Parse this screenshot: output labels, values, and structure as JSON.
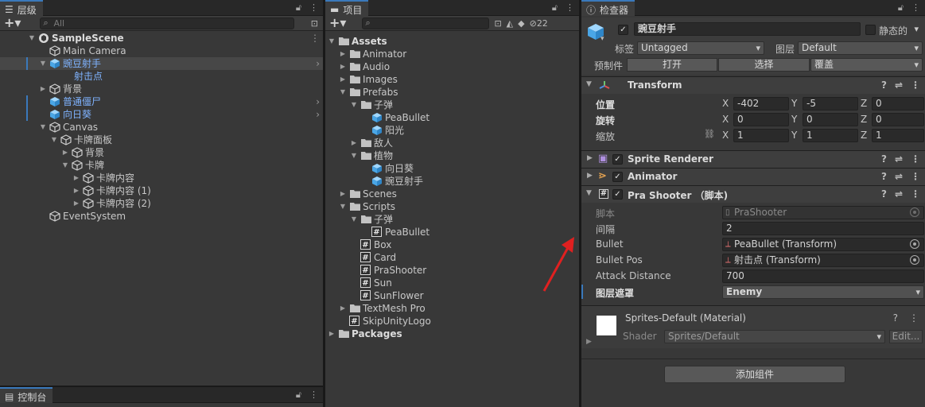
{
  "hierarchy": {
    "tab": "层级",
    "search_placeholder": "All",
    "items": [
      {
        "label": "SampleScene",
        "depth": 0,
        "arrow": "down",
        "icon": "unity-scene-icon",
        "bold": true,
        "selected": false,
        "blue": false,
        "chevron": false
      },
      {
        "label": "Main Camera",
        "depth": 1,
        "arrow": "none",
        "icon": "gameobject-icon",
        "selected": false,
        "blue": false,
        "chevron": false
      },
      {
        "label": "豌豆射手",
        "depth": 1,
        "arrow": "down",
        "icon": "prefab-icon",
        "selected": true,
        "blue": true,
        "chevron": true
      },
      {
        "label": "射击点",
        "depth": 2,
        "arrow": "none",
        "icon": "none",
        "selected": false,
        "blue": true,
        "chevron": false
      },
      {
        "label": "背景",
        "depth": 1,
        "arrow": "right",
        "icon": "gameobject-icon",
        "selected": false,
        "blue": false,
        "chevron": false
      },
      {
        "label": "普通僵尸",
        "depth": 1,
        "arrow": "none",
        "icon": "prefab-icon",
        "selected": false,
        "blue": true,
        "chevron": true
      },
      {
        "label": "向日葵",
        "depth": 1,
        "arrow": "none",
        "icon": "prefab-icon",
        "selected": false,
        "blue": true,
        "chevron": true
      },
      {
        "label": "Canvas",
        "depth": 1,
        "arrow": "down",
        "icon": "gameobject-icon",
        "selected": false,
        "blue": false,
        "chevron": false
      },
      {
        "label": "卡牌面板",
        "depth": 2,
        "arrow": "down",
        "icon": "gameobject-icon",
        "selected": false,
        "blue": false,
        "chevron": false
      },
      {
        "label": "背景",
        "depth": 3,
        "arrow": "right",
        "icon": "gameobject-icon",
        "selected": false,
        "blue": false,
        "chevron": false
      },
      {
        "label": "卡牌",
        "depth": 3,
        "arrow": "down",
        "icon": "gameobject-icon",
        "selected": false,
        "blue": false,
        "chevron": false
      },
      {
        "label": "卡牌内容",
        "depth": 4,
        "arrow": "right",
        "icon": "gameobject-icon",
        "selected": false,
        "blue": false,
        "chevron": false
      },
      {
        "label": "卡牌内容 (1)",
        "depth": 4,
        "arrow": "right",
        "icon": "gameobject-icon",
        "selected": false,
        "blue": false,
        "chevron": false
      },
      {
        "label": "卡牌内容 (2)",
        "depth": 4,
        "arrow": "right",
        "icon": "gameobject-icon",
        "selected": false,
        "blue": false,
        "chevron": false
      },
      {
        "label": "EventSystem",
        "depth": 1,
        "arrow": "none",
        "icon": "gameobject-icon",
        "selected": false,
        "blue": false,
        "chevron": false
      }
    ]
  },
  "console": {
    "tab": "控制台"
  },
  "project": {
    "tab": "项目",
    "hidden_count": "22",
    "items": [
      {
        "label": "Assets",
        "depth": 0,
        "arrow": "down",
        "icon": "folder-icon",
        "bold": true
      },
      {
        "label": "Animator",
        "depth": 1,
        "arrow": "right",
        "icon": "folder-icon"
      },
      {
        "label": "Audio",
        "depth": 1,
        "arrow": "right",
        "icon": "folder-icon"
      },
      {
        "label": "Images",
        "depth": 1,
        "arrow": "right",
        "icon": "folder-icon"
      },
      {
        "label": "Prefabs",
        "depth": 1,
        "arrow": "down",
        "icon": "folder-icon"
      },
      {
        "label": "子弹",
        "depth": 2,
        "arrow": "down",
        "icon": "folder-icon"
      },
      {
        "label": "PeaBullet",
        "depth": 3,
        "arrow": "none",
        "icon": "prefab-icon"
      },
      {
        "label": "阳光",
        "depth": 3,
        "arrow": "none",
        "icon": "prefab-icon"
      },
      {
        "label": "敌人",
        "depth": 2,
        "arrow": "right",
        "icon": "folder-icon"
      },
      {
        "label": "植物",
        "depth": 2,
        "arrow": "down",
        "icon": "folder-icon"
      },
      {
        "label": "向日葵",
        "depth": 3,
        "arrow": "none",
        "icon": "prefab-icon"
      },
      {
        "label": "豌豆射手",
        "depth": 3,
        "arrow": "none",
        "icon": "prefab-icon"
      },
      {
        "label": "Scenes",
        "depth": 1,
        "arrow": "right",
        "icon": "folder-icon"
      },
      {
        "label": "Scripts",
        "depth": 1,
        "arrow": "down",
        "icon": "folder-icon"
      },
      {
        "label": "子弹",
        "depth": 2,
        "arrow": "down",
        "icon": "folder-icon"
      },
      {
        "label": "PeaBullet",
        "depth": 3,
        "arrow": "none",
        "icon": "script-icon"
      },
      {
        "label": "Box",
        "depth": 2,
        "arrow": "none",
        "icon": "script-icon"
      },
      {
        "label": "Card",
        "depth": 2,
        "arrow": "none",
        "icon": "script-icon"
      },
      {
        "label": "PraShooter",
        "depth": 2,
        "arrow": "none",
        "icon": "script-icon"
      },
      {
        "label": "Sun",
        "depth": 2,
        "arrow": "none",
        "icon": "script-icon"
      },
      {
        "label": "SunFlower",
        "depth": 2,
        "arrow": "none",
        "icon": "script-icon"
      },
      {
        "label": "TextMesh Pro",
        "depth": 1,
        "arrow": "right",
        "icon": "folder-icon"
      },
      {
        "label": "SkipUnityLogo",
        "depth": 1,
        "arrow": "none",
        "icon": "script-icon"
      },
      {
        "label": "Packages",
        "depth": 0,
        "arrow": "right",
        "icon": "folder-icon",
        "bold": true
      }
    ]
  },
  "inspector": {
    "tab": "检查器",
    "object_name": "豌豆射手",
    "static_label": "静态的",
    "tag_label": "标签",
    "tag_value": "Untagged",
    "layer_label": "图层",
    "layer_value": "Default",
    "prefab_label": "预制件",
    "open_label": "打开",
    "select_label": "选择",
    "override_label": "覆盖",
    "transform": {
      "title": "Transform",
      "position_label": "位置",
      "rotation_label": "旋转",
      "scale_label": "缩放",
      "position": {
        "x": "-402",
        "y": "-5",
        "z": "0"
      },
      "rotation": {
        "x": "0",
        "y": "0",
        "z": "0"
      },
      "scale": {
        "x": "1",
        "y": "1",
        "z": "1"
      }
    },
    "sprite_renderer_title": "Sprite Renderer",
    "animator_title": "Animator",
    "script_component": {
      "title": "Pra Shooter （脚本)",
      "script_label": "脚本",
      "script_value": "PraShooter",
      "interval_label": "间隔",
      "interval_value": "2",
      "bullet_label": "Bullet",
      "bullet_value": "PeaBullet (Transform)",
      "bullet_pos_label": "Bullet Pos",
      "bullet_pos_value": "射击点 (Transform)",
      "attack_distance_label": "Attack Distance",
      "attack_distance_value": "700",
      "layer_mask_label": "图层遮罩",
      "layer_mask_value": "Enemy"
    },
    "material": {
      "title": "Sprites-Default (Material)",
      "shader_label": "Shader",
      "shader_value": "Sprites/Default",
      "edit_label": "Edit..."
    },
    "add_component_label": "添加组件"
  },
  "colors": {
    "accent": "#3a79bb",
    "prefab_blue": "#7fb3ff",
    "arrow_red": "#e02020"
  }
}
